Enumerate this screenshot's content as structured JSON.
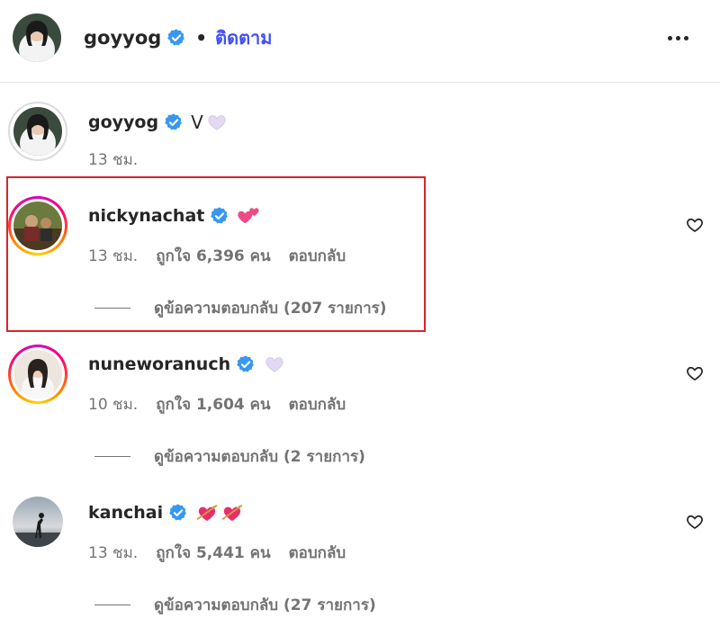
{
  "header": {
    "username": "goyyog",
    "separator": "•",
    "follow_label": "ติดตาม"
  },
  "comments": [
    {
      "username": "goyyog",
      "text": "V",
      "emoji": [
        "light-purple-heart"
      ],
      "time": "13 ชม."
    },
    {
      "username": "nickynachat",
      "text": "",
      "emoji": [
        "two-hearts"
      ],
      "time": "13 ชม.",
      "likes": "ถูกใจ 6,396 คน",
      "reply_label": "ตอบกลับ",
      "view_replies": "ดูข้อความตอบกลับ (207 รายการ)"
    },
    {
      "username": "nuneworanuch",
      "text": "",
      "emoji": [
        "light-purple-heart"
      ],
      "time": "10 ชม.",
      "likes": "ถูกใจ 1,604 คน",
      "reply_label": "ตอบกลับ",
      "view_replies": "ดูข้อความตอบกลับ (2 รายการ)"
    },
    {
      "username": "kanchai",
      "text": "",
      "emoji": [
        "heart-with-arrow",
        "heart-with-arrow"
      ],
      "time": "13 ชม.",
      "likes": "ถูกใจ 5,441 คน",
      "reply_label": "ตอบกลับ",
      "view_replies": "ดูข้อความตอบกลับ (27 รายการ)"
    }
  ],
  "colors": {
    "verified": "#3897f0",
    "follow": "#4150f7",
    "highlight": "#d8242c",
    "meta_text": "#737373"
  }
}
